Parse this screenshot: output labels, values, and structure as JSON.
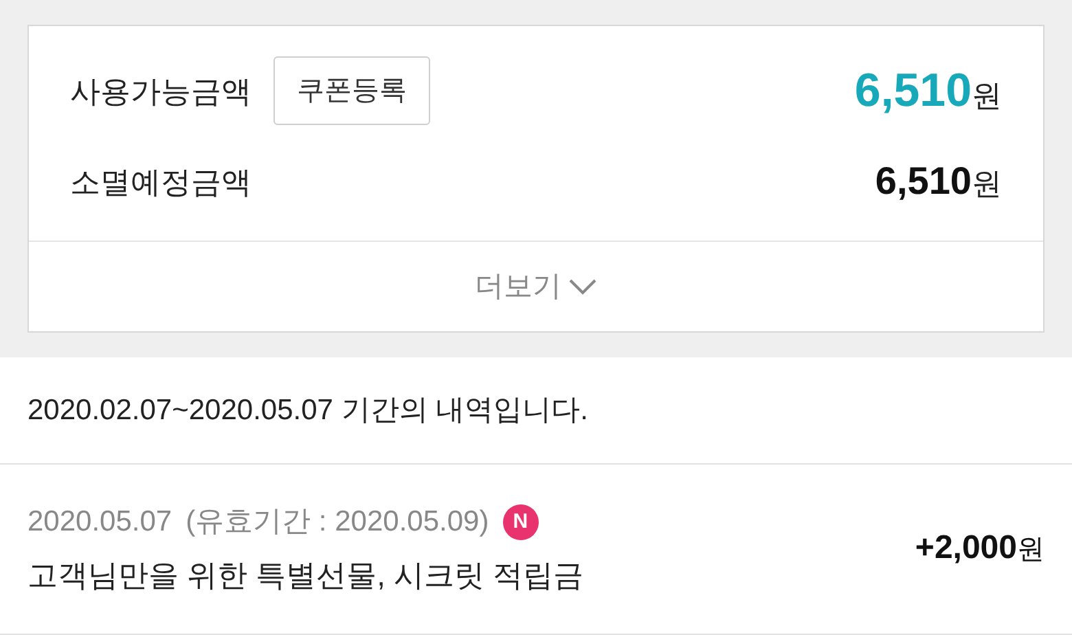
{
  "summary": {
    "rows": [
      {
        "label": "사용가능금액",
        "button": "쿠폰등록",
        "amount": "6,510",
        "unit": "원",
        "highlight": true
      },
      {
        "label": "소멸예정금액",
        "amount": "6,510",
        "unit": "원",
        "highlight": false
      }
    ],
    "more": "더보기"
  },
  "period": "2020.02.07~2020.05.07 기간의 내역입니다.",
  "history": [
    {
      "date": "2020.05.07",
      "validity": "(유효기간 : 2020.05.09)",
      "badge": "N",
      "title": "고객님만을 위한 특별선물, 시크릿 적립금",
      "amount": "+2,000",
      "unit": "원"
    }
  ]
}
